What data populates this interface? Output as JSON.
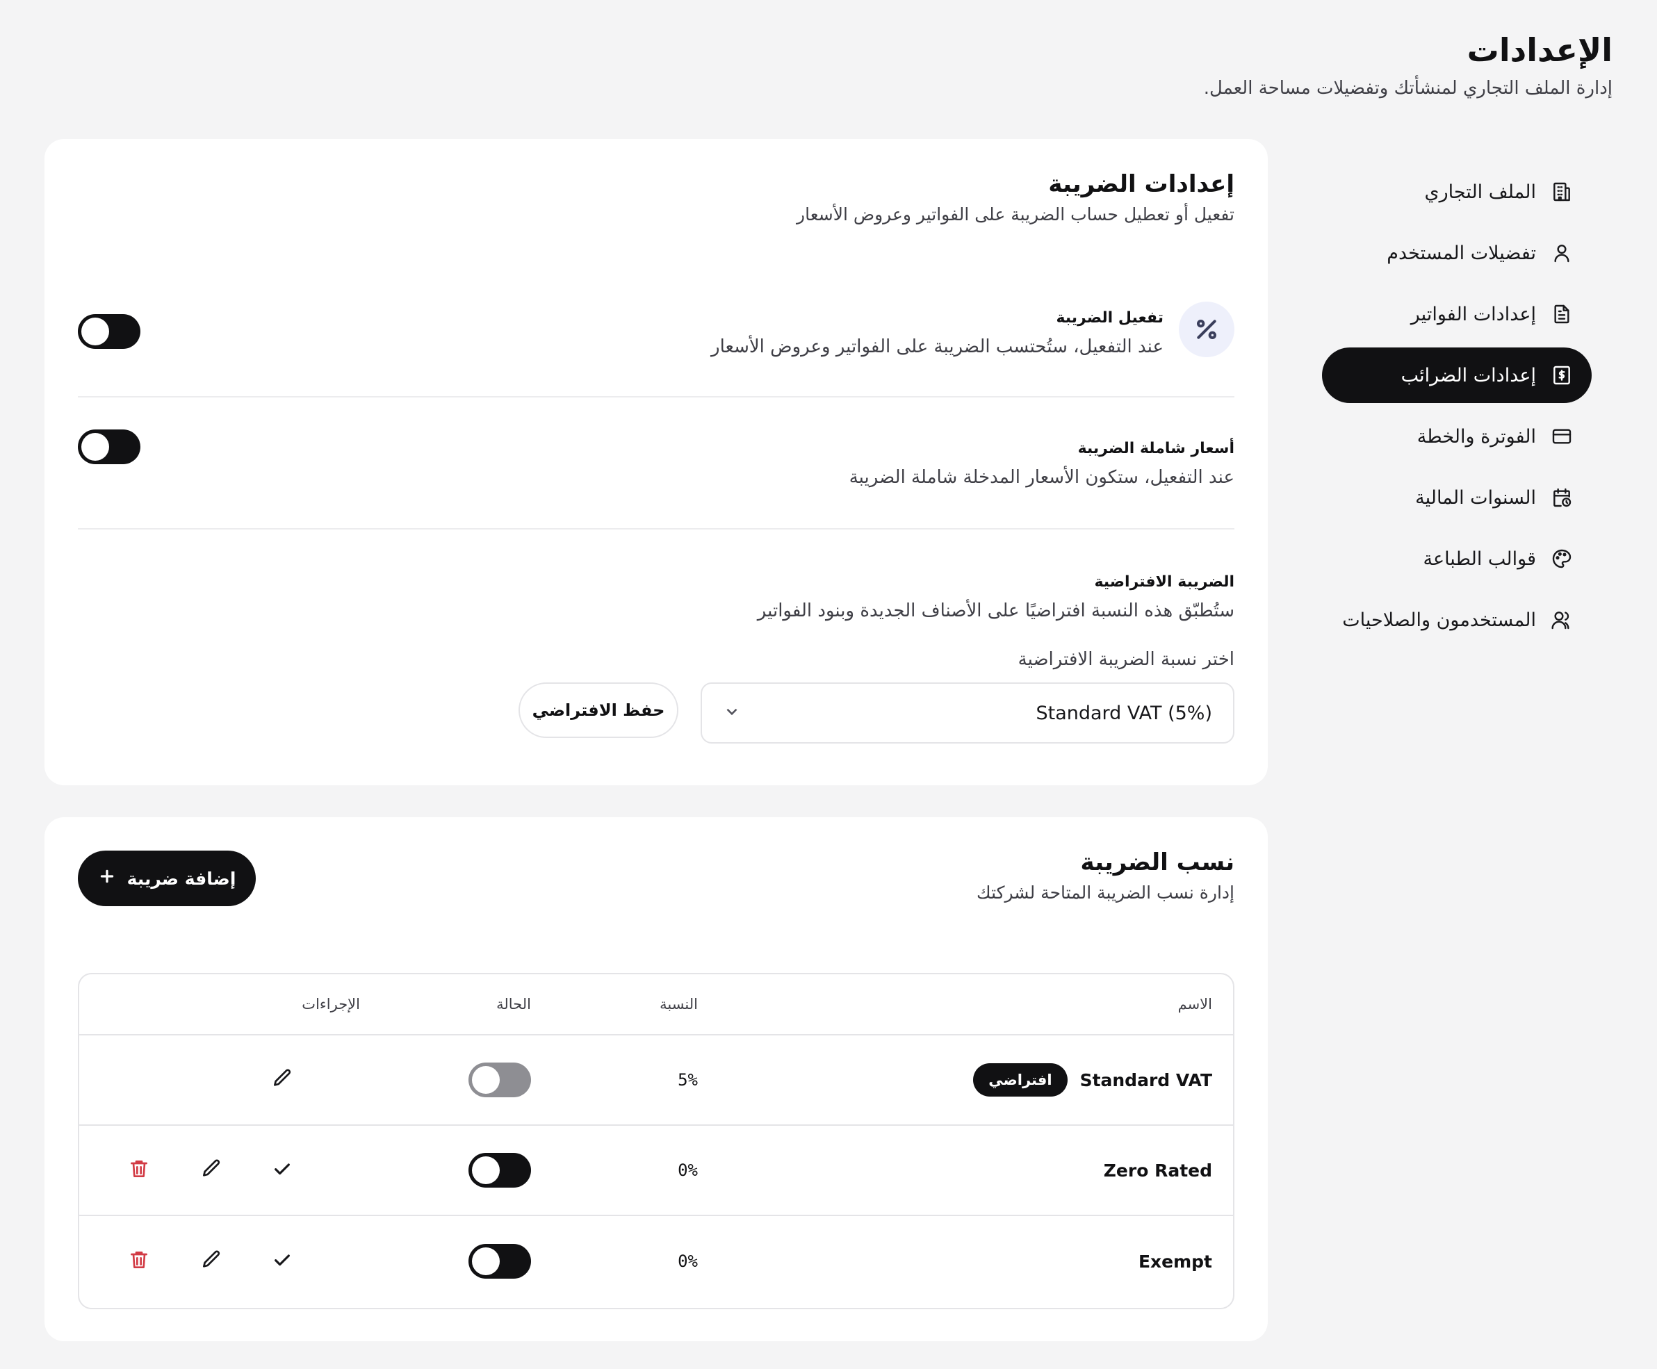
{
  "header": {
    "title": "الإعدادات",
    "subtitle": "إدارة الملف التجاري لمنشأتك وتفضيلات مساحة العمل."
  },
  "sidebar": {
    "items": [
      {
        "label": "الملف التجاري",
        "icon": "building-icon",
        "active": false
      },
      {
        "label": "تفضيلات المستخدم",
        "icon": "user-icon",
        "active": false
      },
      {
        "label": "إعدادات الفواتير",
        "icon": "document-icon",
        "active": false
      },
      {
        "label": "إعدادات الضرائب",
        "icon": "receipt-dollar-icon",
        "active": true
      },
      {
        "label": "الفوترة والخطة",
        "icon": "credit-card-icon",
        "active": false
      },
      {
        "label": "السنوات المالية",
        "icon": "calendar-clock-icon",
        "active": false
      },
      {
        "label": "قوالب الطباعة",
        "icon": "palette-icon",
        "active": false
      },
      {
        "label": "المستخدمون والصلاحيات",
        "icon": "users-icon",
        "active": false
      }
    ]
  },
  "tax_settings": {
    "title": "إعدادات الضريبة",
    "description": "تفعيل أو تعطيل حساب الضريبة على الفواتير وعروض الأسعار",
    "enable_tax": {
      "icon": "percent-icon",
      "label": "تفعيل الضريبة",
      "description": "عند التفعيل، ستُحتسب الضريبة على الفواتير وعروض الأسعار",
      "enabled": false
    },
    "tax_inclusive": {
      "label": "أسعار شاملة الضريبة",
      "description": "عند التفعيل، ستكون الأسعار المدخلة شاملة الضريبة",
      "enabled": false
    },
    "default_tax": {
      "label": "الضريبة الافتراضية",
      "description": "ستُطبّق هذه النسبة افتراضيًا على الأصناف الجديدة وبنود الفواتير",
      "select_label": "اختر نسبة الضريبة الافتراضية",
      "selected": "Standard VAT (5%)",
      "save_label": "حفظ الافتراضي"
    }
  },
  "tax_rates": {
    "title": "نسب الضريبة",
    "description": "إدارة نسب الضريبة المتاحة لشركتك",
    "add_label": "إضافة ضريبة",
    "columns": {
      "name": "الاسم",
      "rate": "النسبة",
      "status": "الحالة",
      "actions": "الإجراءات"
    },
    "rows": [
      {
        "name": "Standard VAT",
        "badge": "افتراضي",
        "rate": "5%",
        "status_on": false,
        "is_default": true
      },
      {
        "name": "Zero Rated",
        "badge": "",
        "rate": "0%",
        "status_on": false,
        "is_default": false
      },
      {
        "name": "Exempt",
        "badge": "",
        "rate": "0%",
        "status_on": false,
        "is_default": false
      }
    ]
  },
  "colors": {
    "primary": "#111113",
    "background": "#f4f4f5",
    "danger": "#d23b45",
    "badge_bg": "#eef0fb"
  }
}
